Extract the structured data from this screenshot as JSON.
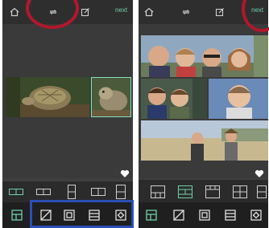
{
  "left": {
    "next_label": "next"
  },
  "right": {
    "next_label": "next"
  },
  "colors": {
    "accent": "#6fd0a8",
    "annotation_circle": "#b0182c",
    "annotation_rect": "#2a4fb5"
  },
  "icons": {
    "top": [
      "home-icon",
      "rotate-icon",
      "edit-icon"
    ],
    "bottom": [
      "layout-icon",
      "ratio-icon",
      "border-icon",
      "grid-icon",
      "filter-icon"
    ]
  }
}
